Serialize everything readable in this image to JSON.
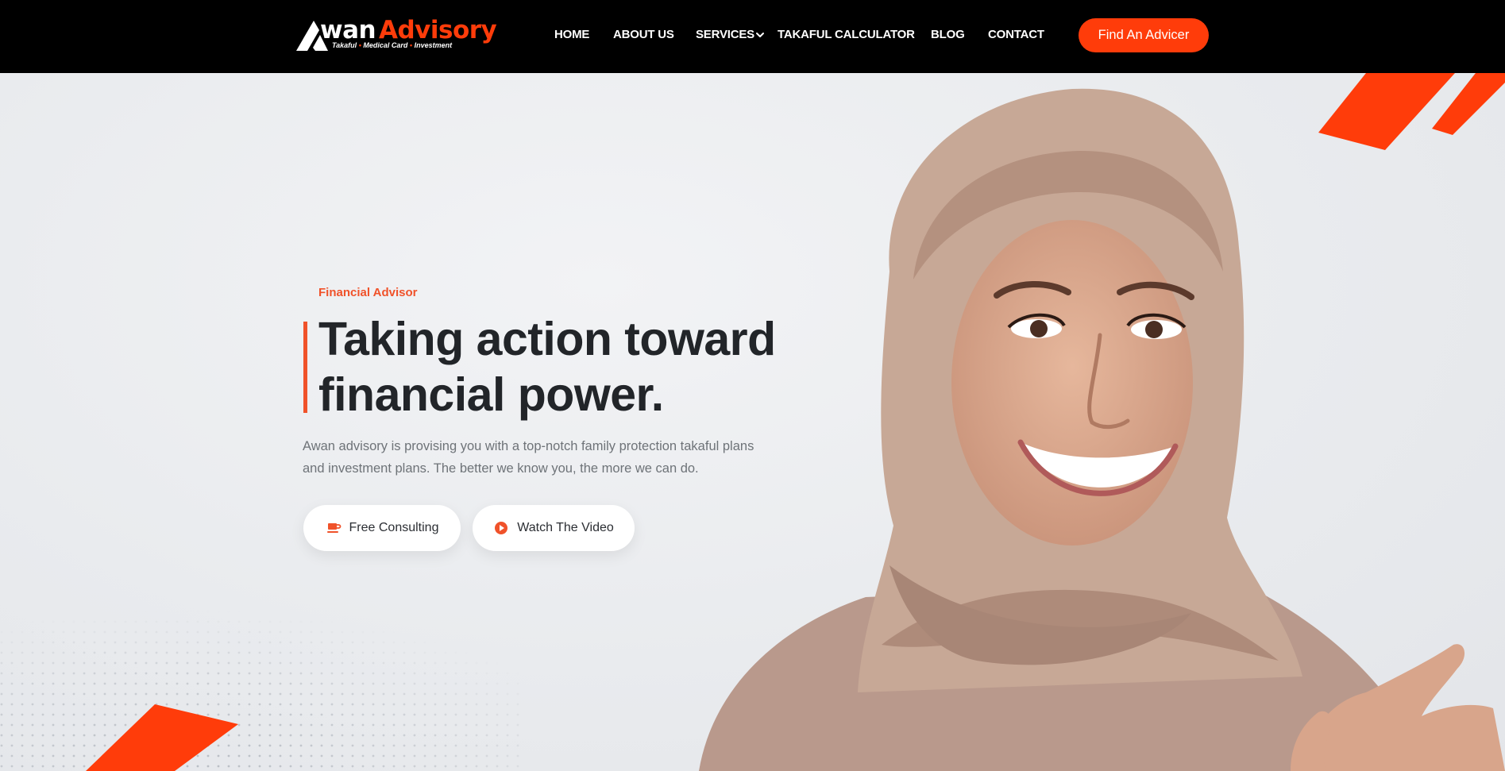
{
  "brand": {
    "name_part1": "wan",
    "name_part2": "Advisory",
    "tagline_1": "Takaful",
    "tagline_2": "Medical Card",
    "tagline_3": "Investment",
    "tagline_sep": "•",
    "accent_color": "#ff3c0a"
  },
  "nav": {
    "items": [
      {
        "label": "HOME"
      },
      {
        "label": "ABOUT US"
      },
      {
        "label": "SERVICES"
      },
      {
        "label": "TAKAFUL CALCULATOR"
      },
      {
        "label": "BLOG"
      },
      {
        "label": "CONTACT"
      }
    ],
    "cta_label": "Find An Advicer"
  },
  "hero": {
    "eyebrow": "Financial Advisor",
    "headline_line1": "Taking action toward",
    "headline_line2": "financial power.",
    "description_line1": "Awan advisory is provising you with a top-notch family protection takaful plans",
    "description_line2": "and investment plans. The better we know you, the more we can do.",
    "btn_consult_label": "Free Consulting",
    "btn_consult_icon": "coffee-cup-icon",
    "btn_video_label": "Watch The Video",
    "btn_video_icon": "play-circle-icon",
    "image": "smiling-woman-in-hijab-photo"
  }
}
